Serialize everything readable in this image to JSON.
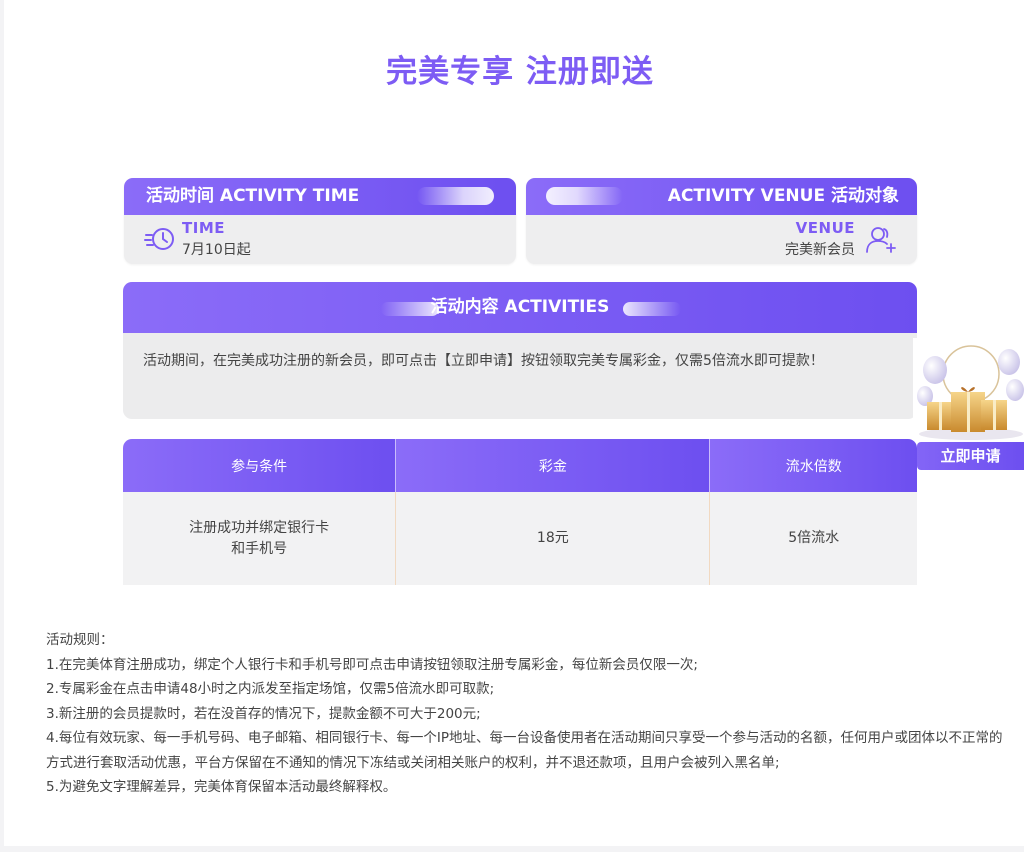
{
  "title": "完美专享 注册即送",
  "time_card": {
    "header": "活动时间 ACTIVITY TIME",
    "label": "TIME",
    "value": "7月10日起",
    "icon": "clock-time-icon"
  },
  "venue_card": {
    "header": "ACTIVITY VENUE 活动对象",
    "label": "VENUE",
    "value": "完美新会员",
    "icon": "user-add-icon"
  },
  "activities": {
    "header": "活动内容 ACTIVITIES",
    "text": "活动期间，在完美成功注册的新会员，即可点击【立即申请】按钮领取完美专属彩金，仅需5倍流水即可提款！"
  },
  "side_widget": {
    "image": "gift-boxes-balloons-icon",
    "apply_label": "立即申请"
  },
  "table": {
    "headers": [
      "参与条件",
      "彩金",
      "流水倍数"
    ],
    "rows": [
      [
        "注册成功并绑定银行卡和手机号",
        "18元",
        "5倍流水"
      ]
    ]
  },
  "rules": {
    "title": "活动规则：",
    "items": [
      "1.在完美体育注册成功，绑定个人银行卡和手机号即可点击申请按钮领取注册专属彩金，每位新会员仅限一次;",
      "2.专属彩金在点击申请48小时之内派发至指定场馆，仅需5倍流水即可取款;",
      "3.新注册的会员提款时，若在没首存的情况下，提款金额不可大于200元;",
      "4.每位有效玩家、每一手机号码、电子邮箱、相同银行卡、每一个IP地址、每一台设备使用者在活动期间只享受一个参与活动的名额，任何用户或团体以不正常的方式进行套取活动优惠，平台方保留在不通知的情况下冻结或关闭相关账户的权利，并不退还款项，且用户会被列入黑名单;",
      "5.为避免文字理解差异，完美体育保留本活动最终解释权。"
    ]
  },
  "colors": {
    "accent": "#7d5cf4",
    "header_gradient_start": "#8b6cf8",
    "header_gradient_end": "#6d4ff0",
    "card_bg": "#eeeeef"
  }
}
